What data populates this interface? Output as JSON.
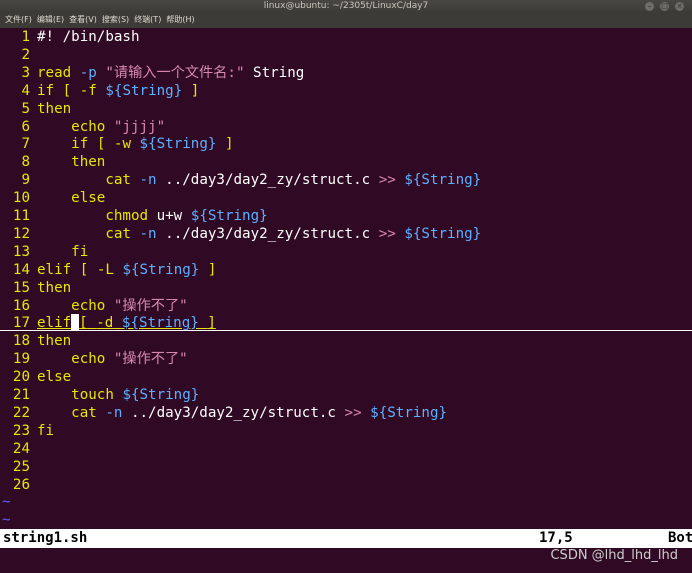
{
  "window": {
    "title": "linux@ubuntu: ~/2305t/LinuxC/day7",
    "controls": [
      "minimize-icon",
      "maximize-icon",
      "close-icon"
    ]
  },
  "menubar": [
    {
      "label": "文件(F)"
    },
    {
      "label": "编辑(E)"
    },
    {
      "label": "查看(V)"
    },
    {
      "label": "搜索(S)"
    },
    {
      "label": "终端(T)"
    },
    {
      "label": "帮助(H)"
    }
  ],
  "editor": {
    "cursor_line": 17,
    "lines": [
      {
        "n": "1",
        "indent": "",
        "segs": [
          [
            "c",
            "#! /bin/bash"
          ]
        ]
      },
      {
        "n": "2",
        "indent": "",
        "segs": []
      },
      {
        "n": "3",
        "indent": "",
        "segs": [
          [
            "k",
            "read"
          ],
          [
            "g",
            " "
          ],
          [
            "p",
            "-p"
          ],
          [
            "g",
            " "
          ],
          [
            "s",
            "\"请输入一个文件名:\""
          ],
          [
            "g",
            " String"
          ]
        ]
      },
      {
        "n": "4",
        "indent": "",
        "segs": [
          [
            "k",
            "if"
          ],
          [
            "g",
            " "
          ],
          [
            "k",
            "["
          ],
          [
            "g",
            " "
          ],
          [
            "k",
            "-f"
          ],
          [
            "g",
            " "
          ],
          [
            "v",
            "${String}"
          ],
          [
            "g",
            " "
          ],
          [
            "k",
            "]"
          ]
        ]
      },
      {
        "n": "5",
        "indent": "",
        "segs": [
          [
            "k",
            "then"
          ]
        ]
      },
      {
        "n": "6",
        "indent": "    ",
        "segs": [
          [
            "k",
            "echo"
          ],
          [
            "g",
            " "
          ],
          [
            "s",
            "\"jjjj\""
          ]
        ]
      },
      {
        "n": "7",
        "indent": "    ",
        "segs": [
          [
            "k",
            "if"
          ],
          [
            "g",
            " "
          ],
          [
            "k",
            "["
          ],
          [
            "g",
            " "
          ],
          [
            "k",
            "-w"
          ],
          [
            "g",
            " "
          ],
          [
            "v",
            "${String}"
          ],
          [
            "g",
            " "
          ],
          [
            "k",
            "]"
          ]
        ]
      },
      {
        "n": "8",
        "indent": "    ",
        "segs": [
          [
            "k",
            "then"
          ]
        ]
      },
      {
        "n": "9",
        "indent": "        ",
        "segs": [
          [
            "k",
            "cat"
          ],
          [
            "g",
            " "
          ],
          [
            "p",
            "-n"
          ],
          [
            "g",
            " ../day3/day2_zy/struct.c "
          ],
          [
            "o",
            ">>"
          ],
          [
            "g",
            " "
          ],
          [
            "v",
            "${String}"
          ]
        ]
      },
      {
        "n": "10",
        "indent": "    ",
        "segs": [
          [
            "k",
            "else"
          ]
        ]
      },
      {
        "n": "11",
        "indent": "        ",
        "segs": [
          [
            "k",
            "chmod"
          ],
          [
            "g",
            " u+w "
          ],
          [
            "v",
            "${String}"
          ]
        ]
      },
      {
        "n": "12",
        "indent": "        ",
        "segs": [
          [
            "k",
            "cat"
          ],
          [
            "g",
            " "
          ],
          [
            "p",
            "-n"
          ],
          [
            "g",
            " ../day3/day2_zy/struct.c "
          ],
          [
            "o",
            ">>"
          ],
          [
            "g",
            " "
          ],
          [
            "v",
            "${String}"
          ]
        ]
      },
      {
        "n": "13",
        "indent": "    ",
        "segs": [
          [
            "k",
            "fi"
          ]
        ]
      },
      {
        "n": "14",
        "indent": "",
        "segs": [
          [
            "k",
            "elif"
          ],
          [
            "g",
            " "
          ],
          [
            "k",
            "["
          ],
          [
            "g",
            " "
          ],
          [
            "k",
            "-L"
          ],
          [
            "g",
            " "
          ],
          [
            "v",
            "${String}"
          ],
          [
            "g",
            " "
          ],
          [
            "k",
            "]"
          ]
        ]
      },
      {
        "n": "15",
        "indent": "",
        "segs": [
          [
            "k",
            "then"
          ]
        ]
      },
      {
        "n": "16",
        "indent": "    ",
        "segs": [
          [
            "k",
            "echo"
          ],
          [
            "g",
            " "
          ],
          [
            "s",
            "\"操作不了\""
          ]
        ]
      },
      {
        "n": "17",
        "indent": "",
        "segs": [
          [
            "k",
            "elif"
          ],
          [
            "cursor",
            ""
          ],
          [
            "k",
            "["
          ],
          [
            "g",
            " "
          ],
          [
            "k",
            "-d"
          ],
          [
            "g",
            " "
          ],
          [
            "v",
            "${String}"
          ],
          [
            "g",
            " "
          ],
          [
            "k",
            "]"
          ]
        ]
      },
      {
        "n": "18",
        "indent": "",
        "segs": [
          [
            "k",
            "then"
          ]
        ]
      },
      {
        "n": "19",
        "indent": "    ",
        "segs": [
          [
            "k",
            "echo"
          ],
          [
            "g",
            " "
          ],
          [
            "s",
            "\"操作不了\""
          ]
        ]
      },
      {
        "n": "20",
        "indent": "",
        "segs": [
          [
            "k",
            "else"
          ]
        ]
      },
      {
        "n": "21",
        "indent": "    ",
        "segs": [
          [
            "k",
            "touch"
          ],
          [
            "g",
            " "
          ],
          [
            "v",
            "${String}"
          ]
        ]
      },
      {
        "n": "22",
        "indent": "    ",
        "segs": [
          [
            "k",
            "cat"
          ],
          [
            "g",
            " "
          ],
          [
            "p",
            "-n"
          ],
          [
            "g",
            " ../day3/day2_zy/struct.c "
          ],
          [
            "o",
            ">>"
          ],
          [
            "g",
            " "
          ],
          [
            "v",
            "${String}"
          ]
        ]
      },
      {
        "n": "23",
        "indent": "",
        "segs": [
          [
            "k",
            "fi"
          ]
        ]
      },
      {
        "n": "24",
        "indent": "",
        "segs": []
      },
      {
        "n": "25",
        "indent": "",
        "segs": []
      },
      {
        "n": "26",
        "indent": "",
        "segs": []
      }
    ],
    "filler_lines": [
      "~",
      "~"
    ]
  },
  "statusline": {
    "filename": "string1.sh",
    "position": "17,5",
    "scroll": "Bot"
  },
  "watermark": "CSDN @lhd_lhd_lhd",
  "colors": {
    "background": "#300a24",
    "keyword": "#e6e600",
    "string": "#d787af",
    "variable": "#5fafff",
    "line_number": "#e6e600",
    "tilde": "#5e5eff"
  }
}
